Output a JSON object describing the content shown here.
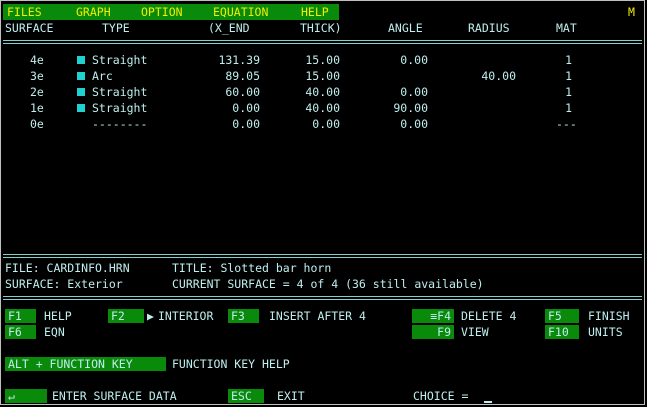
{
  "menu": {
    "items": [
      "FILES",
      "GRAPH",
      "OPTION",
      "EQUATION",
      "HELP"
    ],
    "mode_indicator": "M"
  },
  "table": {
    "headers": [
      "SURFACE",
      "TYPE",
      "(X_END",
      "THICK)",
      "ANGLE",
      "RADIUS",
      "MAT"
    ],
    "rows": [
      {
        "surface": "4e",
        "type": "Straight",
        "x_end": "131.39",
        "thick": "15.00",
        "angle": "0.00",
        "radius": "",
        "mat": "1",
        "marker": true
      },
      {
        "surface": "3e",
        "type": "Arc",
        "x_end": "89.05",
        "thick": "15.00",
        "angle": "",
        "radius": "40.00",
        "mat": "1",
        "marker": true
      },
      {
        "surface": "2e",
        "type": "Straight",
        "x_end": "60.00",
        "thick": "40.00",
        "angle": "0.00",
        "radius": "",
        "mat": "1",
        "marker": true
      },
      {
        "surface": "1e",
        "type": "Straight",
        "x_end": "0.00",
        "thick": "40.00",
        "angle": "90.00",
        "radius": "",
        "mat": "1",
        "marker": true
      },
      {
        "surface": "0e",
        "type": "--------",
        "x_end": "0.00",
        "thick": "0.00",
        "angle": "0.00",
        "radius": "",
        "mat": "---",
        "marker": false
      }
    ]
  },
  "info": {
    "file_label": "FILE: CARDINFO.HRN",
    "title_label": "TITLE: Slotted bar horn",
    "surface_label": "SURFACE: Exterior",
    "current_label": "CURRENT SURFACE = 4 of 4 (36 still available)"
  },
  "function_keys": {
    "f1": {
      "key": "F1",
      "label": "HELP"
    },
    "f6": {
      "key": "F6",
      "label": "EQN"
    },
    "f2": {
      "key": "F2",
      "label": "INTERIOR"
    },
    "f3": {
      "key": "F3",
      "label": "INSERT AFTER 4"
    },
    "f4": {
      "key": "≡F4",
      "label": "DELETE 4"
    },
    "f9": {
      "key": "F9",
      "label": "VIEW"
    },
    "f5": {
      "key": "F5",
      "label": "FINISH"
    },
    "f10": {
      "key": "F10",
      "label": "UNITS"
    }
  },
  "alt_help": {
    "key": "ALT + FUNCTION KEY",
    "label": "FUNCTION KEY HELP"
  },
  "bottom": {
    "enter_key": "↵",
    "enter_label": "ENTER SURFACE DATA",
    "esc_key": "ESC",
    "esc_label": "EXIT",
    "choice_label": "CHOICE ="
  }
}
